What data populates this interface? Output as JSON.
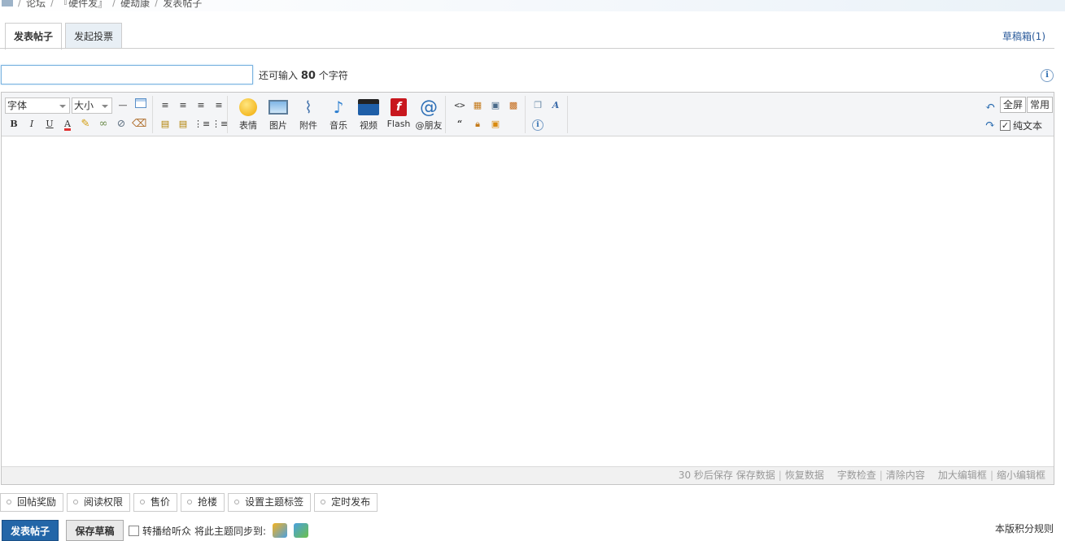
{
  "breadcrumb": {
    "items": [
      "论坛",
      "『硬件发』",
      "硬劫康",
      "发表帖子"
    ]
  },
  "tabs": [
    {
      "label": "发表帖子",
      "active": true
    },
    {
      "label": "发起投票",
      "active": false
    }
  ],
  "drafts": {
    "label": "草稿箱(1)"
  },
  "subject": {
    "value": "",
    "hint_before": "还可输入",
    "count": "80",
    "hint_after": "个字符"
  },
  "toolbar": {
    "font_select": "字体",
    "size_select": "大小",
    "big_buttons": [
      "表情",
      "图片",
      "附件",
      "音乐",
      "视频",
      "Flash",
      "@朋友"
    ],
    "fullscreen": "全屏",
    "common": "常用",
    "plain_text": "纯文本",
    "plain_text_checked": true
  },
  "statusbar": {
    "autosave": "30 秒后保存",
    "save_data": "保存数据",
    "restore_data": "恢复数据",
    "word_check": "字数检查",
    "clear_content": "清除内容",
    "enlarge": "加大编辑框",
    "shrink": "缩小编辑框"
  },
  "options": [
    "回帖奖励",
    "阅读权限",
    "售价",
    "抢楼",
    "设置主题标签",
    "定时发布"
  ],
  "footer": {
    "post_button": "发表帖子",
    "save_draft_button": "保存草稿",
    "broadcast_label": "转播给听众",
    "sync_label": "将此主题同步到:",
    "rules_link": "本版积分规则"
  },
  "colors": {
    "accent": "#2366a8",
    "link": "#2b5b9b",
    "tab_bg": "#e8eff5"
  }
}
